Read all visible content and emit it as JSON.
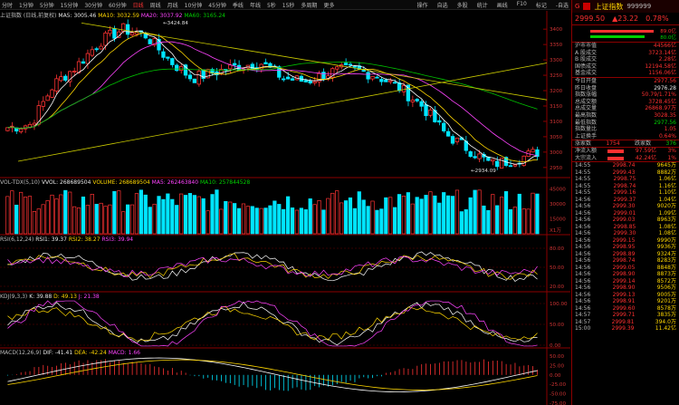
{
  "toolbar": {
    "items": [
      "分时",
      "1分钟",
      "5分钟",
      "15分钟",
      "30分钟",
      "60分钟",
      "日线",
      "周线",
      "月线",
      "10分钟",
      "45分钟",
      "季线",
      "年线",
      "5秒",
      "15秒",
      "多周期",
      "更多"
    ],
    "active": "日线",
    "right": [
      "操作",
      "自选",
      "多股",
      "统计",
      "画线",
      "F10",
      "标记",
      "-自选"
    ]
  },
  "main": {
    "title": "上证指数 (日线,前复权)",
    "ma5": "MA5: 3005.46",
    "ma10": "MA10: 3032.59",
    "ma20": "MA20: 3037.92",
    "ma60": "MA60: 3165.24",
    "high_label": "3424.84",
    "low_label": "2934.09",
    "yticks": [
      "3400",
      "3350",
      "3300",
      "3250",
      "3200",
      "3150",
      "3100",
      "3050",
      "3000",
      "2950"
    ]
  },
  "vol": {
    "title": "VOL-TDX(5,10)",
    "vvol": "VVOL: 268689504",
    "volume": "VOLUME: 268689504",
    "ma5": "MA5: 262463840",
    "ma10": "MA10: 257844528",
    "yticks": [
      "45000",
      "30000",
      "15000"
    ],
    "unit": "X1万"
  },
  "rsi": {
    "title": "RSI(6,12,24)",
    "rsi1": "RSI1: 39.37",
    "rsi2": "RSI2: 38.27",
    "rsi3": "RSI3: 39.94",
    "yticks": [
      "80.00",
      "50.00",
      "20.00"
    ]
  },
  "kdj": {
    "title": "KDJ(9,3,3)",
    "k": "K: 39.88",
    "d": "D: 49.13",
    "j": "J: 21.38",
    "yticks": [
      "100.00",
      "50.00",
      "0.00"
    ]
  },
  "macd": {
    "title": "MACD(12,26,9)",
    "dif": "DIF: -41.41",
    "dea": "DEA: -42.24",
    "macd": "MACD: 1.66",
    "yticks": [
      "50.00",
      "25.00",
      "0.00",
      "-25.00",
      "-50.00",
      "-75.00"
    ]
  },
  "side": {
    "code_tag": "G",
    "name": "上证指数",
    "code": "999999",
    "price": "2999.50",
    "change": "▲23.22",
    "pct": "0.78%",
    "bar_up": "89.0亿",
    "bar_dn": "80.0亿",
    "rows": [
      [
        "沪市市值",
        "44566亿"
      ],
      [
        "A 股成交",
        "3723.14亿"
      ],
      [
        "B 股成交",
        "2.28亿"
      ],
      [
        "国债成交",
        "12194.58亿"
      ],
      [
        "基金成交",
        "1156.06亿"
      ]
    ],
    "rows2": [
      [
        "今日开盘",
        "2977.56"
      ],
      [
        "昨日收盘",
        "2976.28"
      ],
      [
        "指数涨幅",
        "50.79/1.71%"
      ],
      [
        "总成交额",
        "3728.45亿"
      ],
      [
        "总成交量",
        "26868.97万"
      ],
      [
        "最高指数",
        "3028.35"
      ],
      [
        "最低指数",
        "2977.56"
      ],
      [
        "指数量比",
        "1.05"
      ],
      [
        "上证换手",
        "0.64%"
      ]
    ],
    "updown": {
      "up_label": "涨家数",
      "up": "1754",
      "dn_label": "跌家数",
      "dn": "376"
    },
    "flows": [
      [
        "净流入额",
        "97.59亿",
        "3%"
      ],
      [
        "大宗流入",
        "42.24亿",
        "1%"
      ]
    ],
    "ticks": [
      [
        "14:55",
        "2998.74",
        "9645万"
      ],
      [
        "14:55",
        "2999.43",
        "8882万"
      ],
      [
        "14:55",
        "2998.75",
        "1.06亿"
      ],
      [
        "14:55",
        "2998.74",
        "1.16亿"
      ],
      [
        "14:55",
        "2999.16",
        "1.10亿"
      ],
      [
        "14:56",
        "2999.37",
        "1.04亿"
      ],
      [
        "14:56",
        "2999.30",
        "9020万"
      ],
      [
        "14:56",
        "2999.01",
        "1.09亿"
      ],
      [
        "14:56",
        "2999.03",
        "8963万"
      ],
      [
        "14:56",
        "2998.85",
        "1.08亿"
      ],
      [
        "14:56",
        "2999.30",
        "1.08亿"
      ],
      [
        "14:56",
        "2999.15",
        "9990万"
      ],
      [
        "14:56",
        "2998.95",
        "9936万"
      ],
      [
        "14:56",
        "2998.89",
        "9324万"
      ],
      [
        "14:56",
        "2998.74",
        "8283万"
      ],
      [
        "14:56",
        "2999.05",
        "8848万"
      ],
      [
        "14:56",
        "2998.90",
        "8873万"
      ],
      [
        "14:56",
        "2999.14",
        "8572万"
      ],
      [
        "14:56",
        "2998.90",
        "9506万"
      ],
      [
        "14:56",
        "2999.13",
        "9005万"
      ],
      [
        "14:56",
        "2998.91",
        "9201万"
      ],
      [
        "14:56",
        "2999.60",
        "8578万"
      ],
      [
        "14:57",
        "2999.71",
        "3835万"
      ],
      [
        "14:57",
        "2999.81",
        "394.0万"
      ],
      [
        "15:00",
        "2999.39",
        "11.42亿"
      ]
    ]
  },
  "chart_data": {
    "type": "candlestick",
    "note": "Shanghai Composite daily candles",
    "ylim": [
      2920,
      3430
    ],
    "series": [
      {
        "name": "MA5",
        "color": "#ffffff"
      },
      {
        "name": "MA10",
        "color": "#ffd700"
      },
      {
        "name": "MA20",
        "color": "#ff44ff"
      },
      {
        "name": "MA60",
        "color": "#00c000"
      }
    ]
  }
}
